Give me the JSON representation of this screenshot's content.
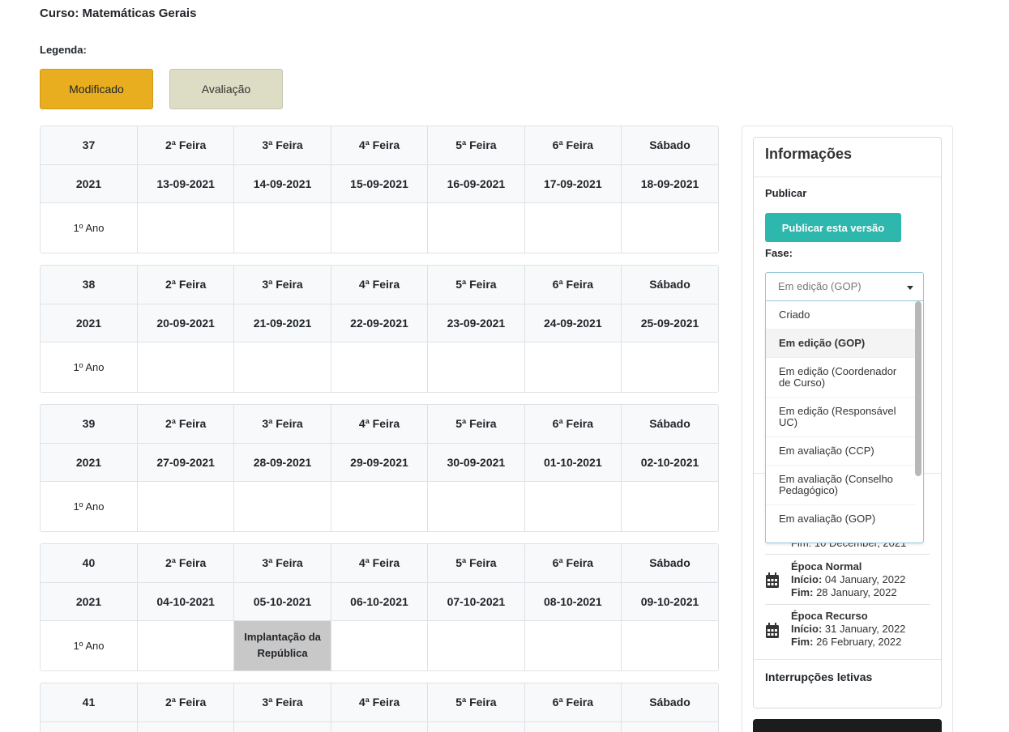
{
  "course": {
    "title": "Curso: Matemáticas Gerais"
  },
  "legend": {
    "label": "Legenda:",
    "items": [
      {
        "label": "Modificado",
        "color": "#e8ae1f"
      },
      {
        "label": "Avaliação",
        "color": "#dddcc4"
      }
    ]
  },
  "days": [
    "2ª Feira",
    "3ª Feira",
    "4ª Feira",
    "5ª Feira",
    "6ª Feira",
    "Sábado"
  ],
  "weeks": [
    {
      "number": "37",
      "year": "2021",
      "dates": [
        "13-09-2021",
        "14-09-2021",
        "15-09-2021",
        "16-09-2021",
        "17-09-2021",
        "18-09-2021"
      ],
      "row_label": "1º Ano",
      "cells": [
        "",
        "",
        "",
        "",
        "",
        ""
      ]
    },
    {
      "number": "38",
      "year": "2021",
      "dates": [
        "20-09-2021",
        "21-09-2021",
        "22-09-2021",
        "23-09-2021",
        "24-09-2021",
        "25-09-2021"
      ],
      "row_label": "1º Ano",
      "cells": [
        "",
        "",
        "",
        "",
        "",
        ""
      ]
    },
    {
      "number": "39",
      "year": "2021",
      "dates": [
        "27-09-2021",
        "28-09-2021",
        "29-09-2021",
        "30-09-2021",
        "01-10-2021",
        "02-10-2021"
      ],
      "row_label": "1º Ano",
      "cells": [
        "",
        "",
        "",
        "",
        "",
        ""
      ]
    },
    {
      "number": "40",
      "year": "2021",
      "dates": [
        "04-10-2021",
        "05-10-2021",
        "06-10-2021",
        "07-10-2021",
        "08-10-2021",
        "09-10-2021"
      ],
      "row_label": "1º Ano",
      "cells": [
        "",
        "Implantação da República",
        "",
        "",
        "",
        ""
      ]
    },
    {
      "number": "41"
    }
  ],
  "sidebar": {
    "title": "Informações",
    "publish_label": "Publicar",
    "publish_button": "Publicar esta versão",
    "phase_label": "Fase:",
    "phase_selected": "Em edição (GOP)",
    "phase_options": [
      "Criado",
      "Em edição (GOP)",
      "Em edição (Coordenador de Curso)",
      "Em edição (Responsável UC)",
      "Em avaliação (CCP)",
      "Em avaliação (Conselho Pedagógico)",
      "Em avaliação (GOP)"
    ],
    "partial_end": "Fim: 10 December, 2021",
    "periods": [
      {
        "title": "Época Normal",
        "start_label": "Início:",
        "start": "04 January, 2022",
        "end_label": "Fim:",
        "end": "28 January, 2022"
      },
      {
        "title": "Época Recurso",
        "start_label": "Início:",
        "start": "31 January, 2022",
        "end_label": "Fim:",
        "end": "26 February, 2022"
      }
    ],
    "interruptions_label": "Interrupções letivas"
  }
}
